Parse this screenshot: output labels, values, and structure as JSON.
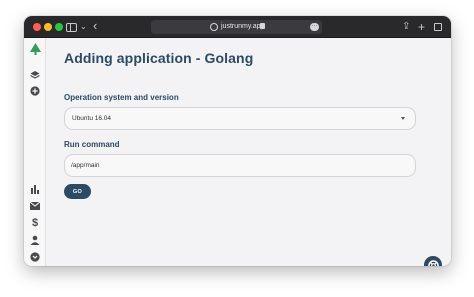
{
  "browser": {
    "url": "justrunmy.app"
  },
  "page": {
    "title": "Adding application - Golang"
  },
  "form": {
    "os_label": "Operation system and version",
    "os_selected": "Ubuntu 16.04",
    "run_label": "Run command",
    "run_value": "/app/main",
    "go_label": "GO"
  },
  "nav": {
    "items": [
      "logo-tree-icon",
      "layers-icon",
      "add-circle-icon",
      "bar-chart-icon",
      "mail-icon",
      "dollar-icon",
      "user-icon",
      "arrow-down-circle-icon"
    ]
  },
  "colors": {
    "brand": "#2c4a66",
    "logo_green": "#3a9a5b",
    "titlebar": "#29282b"
  }
}
